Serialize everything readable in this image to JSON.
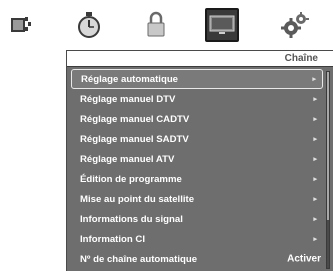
{
  "topbar": {
    "icons": [
      "picture-icon",
      "clock-icon",
      "lock-icon",
      "tv-icon",
      "gears-icon"
    ],
    "selected": "tv-icon"
  },
  "panel": {
    "title": "Chaîne"
  },
  "menu": {
    "items": [
      {
        "label": "Réglage automatique",
        "arrow": "▸",
        "selected": true
      },
      {
        "label": "Réglage manuel DTV",
        "arrow": "▸"
      },
      {
        "label": "Réglage manuel CADTV",
        "arrow": "▸"
      },
      {
        "label": "Réglage manuel SADTV",
        "arrow": "▸"
      },
      {
        "label": "Réglage manuel ATV",
        "arrow": "▸"
      },
      {
        "label": "Édition de programme",
        "arrow": "▸"
      },
      {
        "label": "Mise au point du satellite",
        "arrow": "▸"
      },
      {
        "label": "Informations du signal",
        "arrow": "▸"
      },
      {
        "label": "Information CI",
        "arrow": "▸"
      },
      {
        "label": "Nº de chaîne automatique",
        "value": "Activer"
      }
    ]
  },
  "colors": {
    "panel_bg": "#6e6e6e",
    "selected_tile": "#3a3a3a",
    "text": "#ffffff"
  }
}
